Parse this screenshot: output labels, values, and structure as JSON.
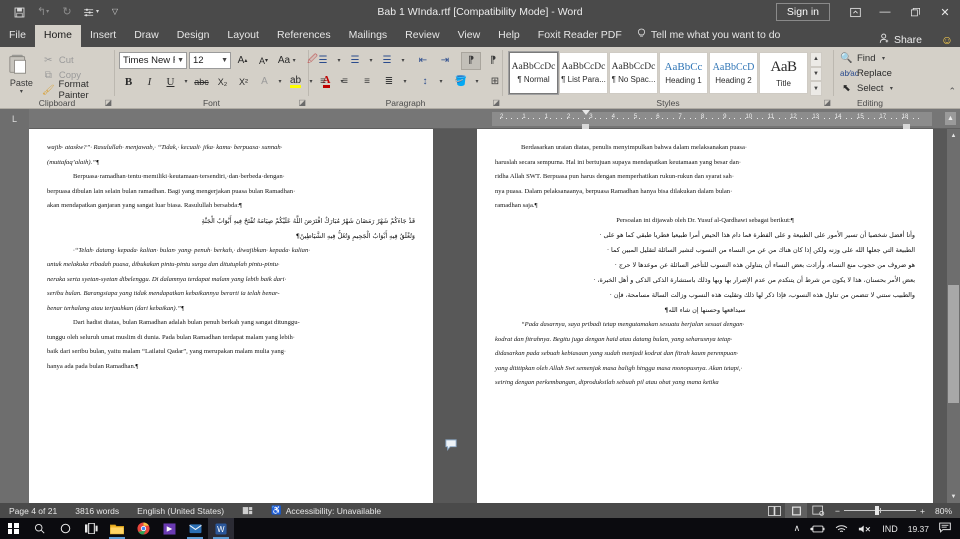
{
  "window": {
    "title": "Bab 1 WInda.rtf [Compatibility Mode]  -  Word",
    "sign_in": "Sign in",
    "ribbon_display_icon": "ribbon-display-options-icon",
    "minimize_icon": "—",
    "restore_icon": "❐",
    "close_icon": "✕"
  },
  "qat": {
    "save": "💾",
    "undo": "↶",
    "redo": "↻",
    "touch": "☲",
    "customize": "⌄"
  },
  "tabs": [
    {
      "label": "File",
      "active": false
    },
    {
      "label": "Home",
      "active": true
    },
    {
      "label": "Insert",
      "active": false
    },
    {
      "label": "Draw",
      "active": false
    },
    {
      "label": "Design",
      "active": false
    },
    {
      "label": "Layout",
      "active": false
    },
    {
      "label": "References",
      "active": false
    },
    {
      "label": "Mailings",
      "active": false
    },
    {
      "label": "Review",
      "active": false
    },
    {
      "label": "View",
      "active": false
    },
    {
      "label": "Help",
      "active": false
    },
    {
      "label": "Foxit Reader PDF",
      "active": false
    }
  ],
  "tellme": {
    "label": "Tell me what you want to do",
    "icon": "💡"
  },
  "share": {
    "label": "Share",
    "icon": "👤"
  },
  "account": {
    "icon": "🙂"
  },
  "ribbon": {
    "clipboard": {
      "label": "Clipboard",
      "paste": "Paste",
      "cut": "Cut",
      "copy": "Copy",
      "format_painter": "Format Painter"
    },
    "font": {
      "label": "Font",
      "font_name": "Times New R",
      "font_size": "12",
      "grow": "A",
      "shrink": "A",
      "change_case": "Aa",
      "clear_formatting": "✐",
      "bold": "B",
      "italic": "I",
      "underline": "U",
      "strikethrough": "abc",
      "subscript": "X₂",
      "superscript": "X²",
      "text_effects": "A",
      "highlight": "ab",
      "font_color": "A"
    },
    "paragraph": {
      "label": "Paragraph",
      "bullets": "≡",
      "numbering": "≡",
      "multilevel": "≡",
      "decrease_indent": "⇤",
      "increase_indent": "⇥",
      "ltr": "¶",
      "rtl": "¶",
      "sort": "↓",
      "show_marks": "¶",
      "align_left": "≡",
      "align_center": "≡",
      "align_right": "≡",
      "justify": "≡",
      "line_spacing": "↕",
      "shading": "■",
      "borders": "⊞"
    },
    "styles": {
      "label": "Styles",
      "items": [
        {
          "preview": "AaBbCcDc",
          "name": "¶ Normal",
          "selected": true
        },
        {
          "preview": "AaBbCcDc",
          "name": "¶ List Para...",
          "selected": false
        },
        {
          "preview": "AaBbCcDc",
          "name": "¶ No Spac...",
          "selected": false
        },
        {
          "preview": "AaBbCc",
          "name": "Heading 1",
          "selected": false
        },
        {
          "preview": "AaBbCcD",
          "name": "Heading 2",
          "selected": false
        },
        {
          "preview": "AaB",
          "name": "Title",
          "selected": false
        }
      ]
    },
    "editing": {
      "label": "Editing",
      "find": "Find",
      "replace": "Replace",
      "select": "Select"
    }
  },
  "ruler": {
    "marks": [
      "2",
      "1",
      "1",
      "2",
      "3",
      "4",
      "5",
      "6",
      "7",
      "8",
      "9",
      "10",
      "11",
      "12",
      "13",
      "14",
      "15",
      "17",
      "18"
    ]
  },
  "document": {
    "left_page": [
      {
        "style": "ital",
        "text": "wajib· ataskw?”· Rasulullah· menjawab,· “Tidak,· kecuali· jika· kamu· berpuasa· sunnah·"
      },
      {
        "style": "ital",
        "text": "(muttafaq’alaih).”¶"
      },
      {
        "style": "ind",
        "text": "Berpuasa·ramadhan·tentu·memiliki·keutamaan·tersendiri,·dan·berbeda·dengan·"
      },
      {
        "style": "",
        "text": "berpuasa dibulan lain selain bulan ramadhan. Bagi yang mengerjakan puasa bulan Ramadhan·"
      },
      {
        "style": "",
        "text": "akan mendapatkan ganjaran yang sangat luar biasa. Rasulullah bersabda:¶"
      },
      {
        "style": "arabic",
        "text": "قَدْ جَاءَكُمْ شَهْرُ رَمَضَانَ شَهْرٌ مُبَارَكٌ افْتَرَضَ اللَّهُ عَلَيْكُمْ صِيَامَهُ تُفْتَحُ فِيهِ أَبْوَابُ الْجَنَّةِ"
      },
      {
        "style": "arabic",
        "text": "وَتُغْلَقُ فِيهِ أَبْوَابُ الْجَحِيمِ وَتُغَلُّ فِيهِ الشَّيَاطِينُ¶"
      },
      {
        "style": "ital ind",
        "text": "·“Telah· datang· kepada· kalian· bulan· yang· penuh· berkah,· diwajibkan· kepada· kalian·"
      },
      {
        "style": "ital",
        "text": "untuk melakuka ribadah puasa, dibukakan pintu-pintu surga dan ditutuplah pintu-pintu·"
      },
      {
        "style": "ital",
        "text": "neraka serta syetan-syetan dibelenggu. Di dalamnya terdapat malam yang lebih baik dari·"
      },
      {
        "style": "ital",
        "text": "seribu bulan. Barangsiapa yang tidak mendapatkan kebaikannya berarti ia telah benar-"
      },
      {
        "style": "ital",
        "text": "benar terhalang atau terjauhkan (dari kebaikan).”¶"
      },
      {
        "style": "ind",
        "text": "Dari hadist diatas, bulan Ramadhan adalah bulan penuh berkah yang sangat ditunggu-"
      },
      {
        "style": "",
        "text": "tunggu oleh seluruh umat muslim di dunia. Pada bulan Ramadhan terdapat malam yang lebih·"
      },
      {
        "style": "",
        "text": "baik dari seribu bulan, yaitu malam “Lailatul Qadar”, yang merupakan malam mulia yang·"
      },
      {
        "style": "",
        "text": "hanya ada pada bulan Ramadhan.¶"
      }
    ],
    "right_page": [
      {
        "style": "ind",
        "text": "Berdasarkan uraian diatas, penulis menyimpulkan bahwa dalam melaksanakan puasa·"
      },
      {
        "style": "",
        "text": "haruslah secara sempurna. Hal ini bertujuan supaya mendapatkan keutamaan yang besar dan·"
      },
      {
        "style": "",
        "text": "ridha Allah SWT. Berpuasa pun harus dengan memperhatikan rukun-rukun dan syarat sah·"
      },
      {
        "style": "",
        "text": "nya puasa. Dalam pelaksanaanya, berpuasa Ramadhan hanya bisa dilakukan dalam bulan·"
      },
      {
        "style": "",
        "text": "ramadhan saja.¶"
      },
      {
        "style": "center",
        "text": "Persoalan ini dijawab oleh Dr. Yusuf al-Qardhawi sebagai berikut:¶"
      },
      {
        "style": "arabic",
        "text": "وأنا أفضل شخصيا أن تسير الأمور على الطبيعة و على الفطرة فما دام هذا الحيض أمرا طبيعيا فطريا طبقي كما هو على ·"
      },
      {
        "style": "arabic",
        "text": "الطبيعة التي جعلها الله على وزنه ولكن إذا كان هناك من عن من النساء من النسوب لتشير السائلة لتقليل المبين كما ·"
      },
      {
        "style": "arabic",
        "text": "هو ضروف من حجوب منع النساء، وأرادت بعض النساء أن يتناولن هذه النسوب للتأخير السائلة عن موعدها لا حرج ·"
      },
      {
        "style": "arabic",
        "text": "بعض الأمر بحسنان، هذا لا يكون من شرط أن يتنكدم من عدم الإضرار بها وبها وذلك باستشارة الذكى الذكى و أهل الخبرة، ·"
      },
      {
        "style": "arabic",
        "text": "والطبيب ستني لا تتضمن من تناول هذه النسوب، فإذا ذكر لها ذلك وتقليت هذه النسوب وزالت السالة مسامحة، فإن ·"
      },
      {
        "style": "arabic-c",
        "text": "سيدافعها وحسنها إن شاء الله¶"
      },
      {
        "style": "ital ind",
        "text": "“Pada dasarnya, saya pribadi tetap mengutamakan sesuatu berjalan sesuai dengan·"
      },
      {
        "style": "ital",
        "text": "kodrat dan fitrahnya. Begitu juga dengan haid atau datang bulan, yang seharusnya tetap·"
      },
      {
        "style": "ital",
        "text": "didasarkan pada sebuah kebiasaan yang sudah menjadi kodrat dan fitrah kaum perempuan·"
      },
      {
        "style": "ital",
        "text": "yang dititipkan oleh Allah Swt semenjak masa baligh hingga masa monopusnya. Akan tetapi,·"
      },
      {
        "style": "ital",
        "text": "seiring dengan perkembangan, diproduksilah sebuah pil atau obat yang mana ketika"
      }
    ],
    "comment_icon": "comment-bubble-icon"
  },
  "status": {
    "page": "Page 4 of 21",
    "words": "3816 words",
    "language": "English (United States)",
    "proofing_icon": "spelling-check-icon",
    "accessibility": "Accessibility: Unavailable",
    "views": [
      {
        "name": "read-mode",
        "icon": "📖",
        "active": false
      },
      {
        "name": "print-layout",
        "icon": "▤",
        "active": true
      },
      {
        "name": "web-layout",
        "icon": "▣",
        "active": false
      }
    ],
    "zoom_out": "−",
    "zoom_in": "+",
    "zoom": "80%"
  },
  "taskbar": {
    "start": "start-button",
    "search": "🔍",
    "cortana": "○",
    "taskview": "☰",
    "apps": [
      {
        "name": "file-explorer",
        "color": "#f6b93b",
        "glyph": "📁"
      },
      {
        "name": "chrome",
        "color": "#e8453c",
        "glyph": "◉"
      },
      {
        "name": "app-purple",
        "color": "#6a3ab2",
        "glyph": "▶"
      },
      {
        "name": "mail",
        "color": "#2a6fb5",
        "glyph": "✉"
      },
      {
        "name": "word",
        "color": "#2b579a",
        "glyph": "W"
      }
    ],
    "tray": {
      "chevron": "∧",
      "battery": "🔋",
      "network": "📶",
      "volume": "🔇",
      "language": "IND",
      "time": "19.37",
      "notifications": "💬"
    }
  }
}
